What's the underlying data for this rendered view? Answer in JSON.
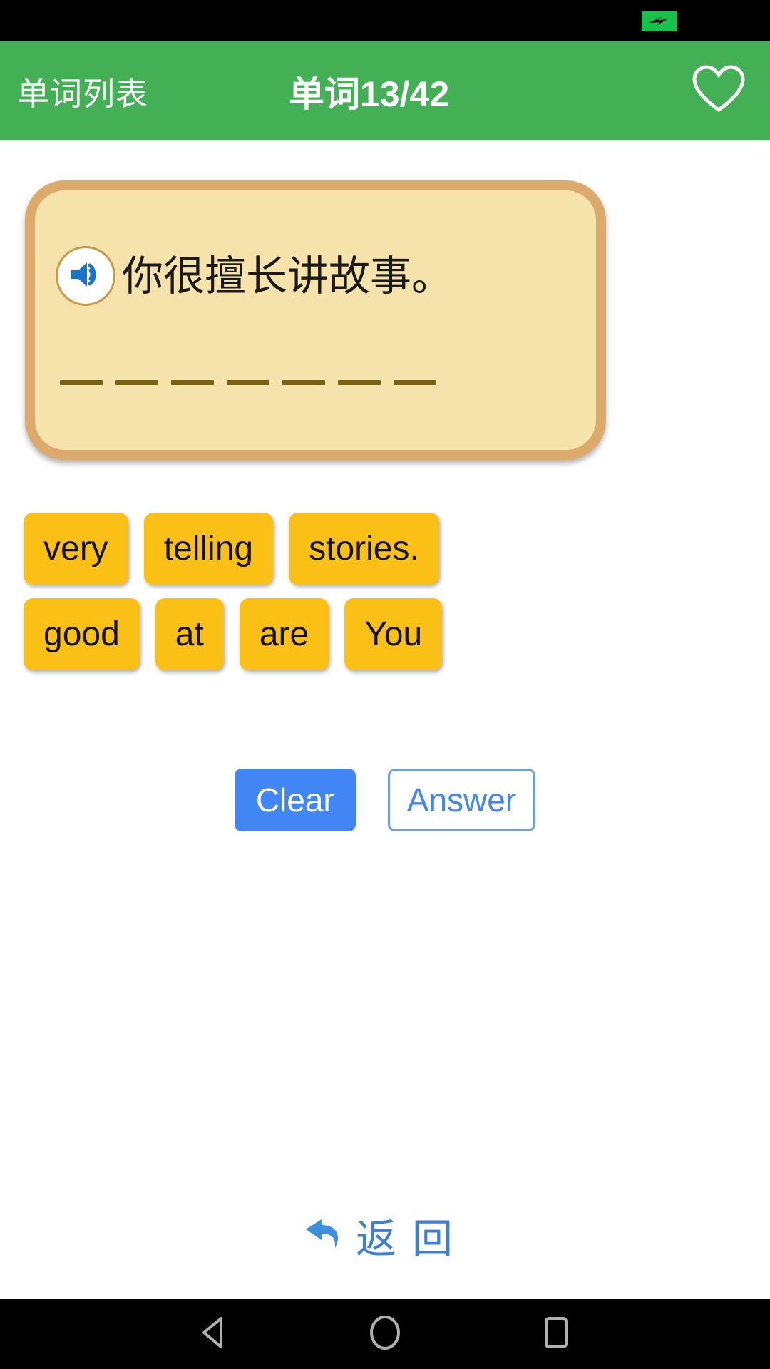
{
  "status_bar": {
    "battery_icon": "battery-charging-icon"
  },
  "app_bar": {
    "back_label": "单词列表",
    "title": "单词13/42",
    "favorite_icon": "heart-icon",
    "bg_color": "#43b055"
  },
  "card": {
    "speaker_icon": "speaker-icon",
    "sentence_cn": "你很擅长讲故事。",
    "blank_count": 7,
    "bg_color": "#f6e3ac",
    "border_color": "#dcab6b"
  },
  "tiles": {
    "rows": [
      [
        "very",
        "telling",
        "stories."
      ],
      [
        "good",
        "at",
        "are",
        "You"
      ]
    ],
    "color": "#fbc016"
  },
  "actions": {
    "clear_label": "Clear",
    "answer_label": "Answer",
    "primary_color": "#4285f4"
  },
  "back": {
    "icon": "undo-arrow-icon",
    "label": "返回",
    "color": "#3d7fd4"
  },
  "nav_bar": {
    "back_icon": "triangle-back-icon",
    "home_icon": "circle-home-icon",
    "recents_icon": "square-recents-icon"
  }
}
